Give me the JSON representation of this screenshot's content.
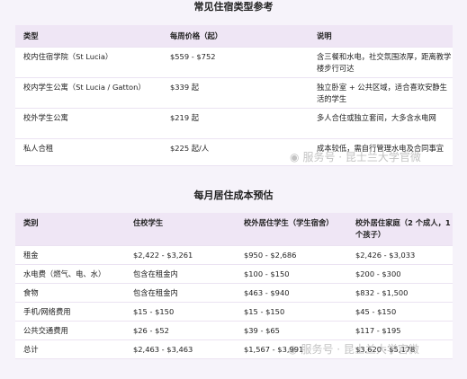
{
  "section1": {
    "title": "常见住宿类型参考",
    "headers": [
      "类型",
      "每周价格（起）",
      "说明"
    ],
    "rows": [
      [
        "校内住宿学院（St Lucia）",
        "$559 - $752",
        "含三餐和水电，社交氛围浓厚，距离教学楼步行可达"
      ],
      [
        "校内学生公寓（St Lucia / Gatton）",
        "$339 起",
        "独立卧室 + 公共区域，适合喜欢安静生活的学生"
      ],
      [
        "校外学生公寓",
        "$219 起",
        "多人合住或独立套间，大多含水电网"
      ],
      [
        "私人合租",
        "$225 起/人",
        "成本较低，需自行管理水电及合同事宜"
      ]
    ]
  },
  "section2": {
    "title": "每月居住成本预估",
    "headers": [
      "类别",
      "住校学生",
      "校外居住学生（学生宿舍）",
      "校外居住家庭（2 个成人，1个孩子）"
    ],
    "rows": [
      [
        "租金",
        "$2,422 - $3,261",
        "$950 - $2,686",
        "$2,426 - $3,033"
      ],
      [
        "水电费（燃气、电、水）",
        "包含在租金内",
        "$100 - $150",
        "$200 - $300"
      ],
      [
        "食物",
        "包含在租金内",
        "$463 - $940",
        "$832 - $1,500"
      ],
      [
        "手机/网络费用",
        "$15 - $150",
        "$15 - $150",
        "$45 - $150"
      ],
      [
        "公共交通费用",
        "$26 - $52",
        "$39 - $65",
        "$117 - $195"
      ],
      [
        "总计",
        "$2,463 - $3,463",
        "$1,567 - $3,991",
        "$3,620 - $5,178"
      ]
    ]
  },
  "watermark": {
    "text": "服务号 · 昆士兰大学官微",
    "icon": "wechat-icon"
  }
}
